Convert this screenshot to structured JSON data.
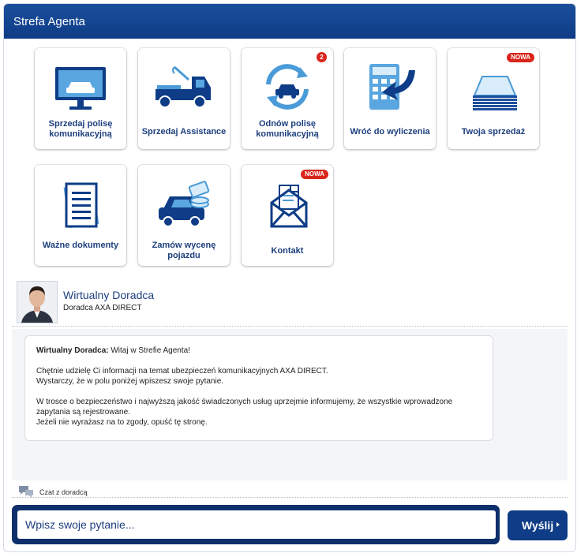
{
  "header": {
    "title": "Strefa Agenta"
  },
  "tiles": [
    {
      "label": "Sprzedaj polisę komunikacyjną",
      "icon": "monitor-car-icon"
    },
    {
      "label": "Sprzedaj Assistance",
      "icon": "tow-truck-icon"
    },
    {
      "label": "Odnów polisę komunikacyjną",
      "icon": "renew-car-icon",
      "badge": "2"
    },
    {
      "label": "Wróć do wyliczenia",
      "icon": "calculator-back-icon"
    },
    {
      "label": "Twoja sprzedaż",
      "icon": "paper-stack-icon",
      "badge": "NOWA"
    },
    {
      "label": "Ważne dokumenty",
      "icon": "document-icon"
    },
    {
      "label": "Zamów wycenę pojazdu",
      "icon": "car-coins-icon"
    },
    {
      "label": "Kontakt",
      "icon": "envelope-icon",
      "badge": "NOWA"
    }
  ],
  "advisor": {
    "name": "Wirtualny Doradca",
    "role": "Doradca AXA DIRECT"
  },
  "message": {
    "author": "Wirtualny Doradca:",
    "greeting": " Witaj w Strefie Agenta!",
    "p1": "Chętnie udzielę Ci informacji na temat ubezpieczeń komunikacyjnych AXA DIRECT.",
    "p2": "Wystarczy, że w polu poniżej wpiszesz swoje pytanie.",
    "p3": "W trosce o bezpieczeństwo i najwyższą jakość świadczonych usług uprzejmie informujemy, że wszystkie wprowadzone zapytania są rejestrowane.",
    "p4": "Jeżeli nie wyrażasz na to zgody, opuść tę stronę."
  },
  "chat_label": "Czat z doradcą",
  "input": {
    "placeholder": "Wpisz swoje pytanie..."
  },
  "send_label": "Wyślij",
  "colors": {
    "brand": "#0e3c86",
    "badge": "#d9251c",
    "icon_light": "#4a9bd8"
  }
}
